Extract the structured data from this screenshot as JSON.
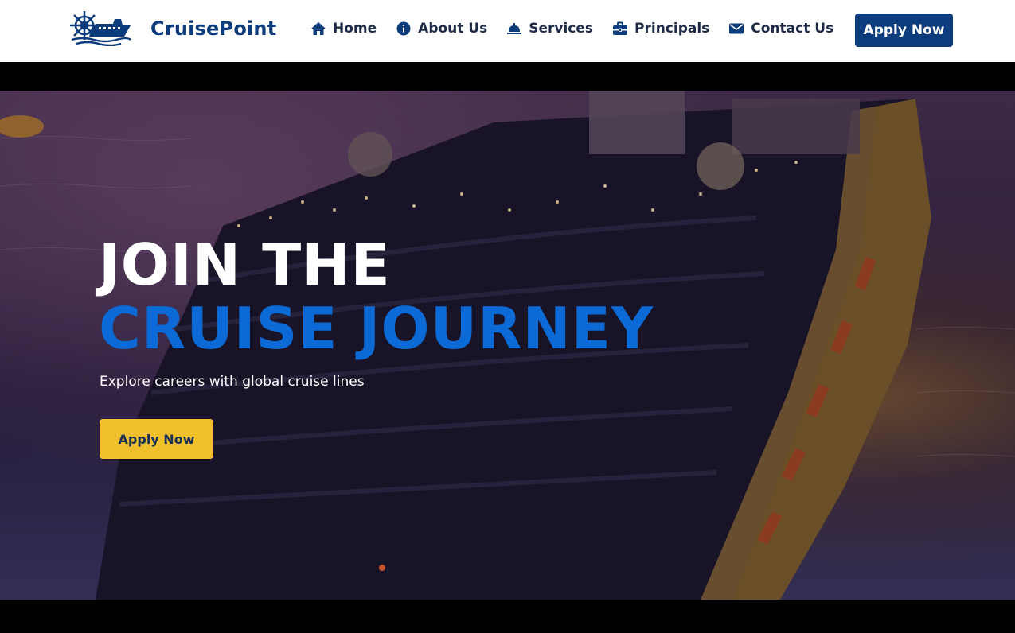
{
  "brand": {
    "name": "CruisePoint",
    "logo_icon": "ship-wheel-icon"
  },
  "nav": {
    "items": [
      {
        "label": "Home",
        "icon": "home-icon"
      },
      {
        "label": "About Us",
        "icon": "info-circle-icon"
      },
      {
        "label": "Services",
        "icon": "bell-icon"
      },
      {
        "label": "Principals",
        "icon": "briefcase-icon"
      },
      {
        "label": "Contact Us",
        "icon": "envelope-icon"
      }
    ],
    "cta_label": "Apply Now"
  },
  "hero": {
    "title_line1": "JOIN THE",
    "title_line2": "CRUISE JOURNEY",
    "subtitle": "Explore careers with global cruise lines",
    "cta_label": "Apply Now"
  },
  "colors": {
    "brand_blue": "#0c3c7c",
    "accent_blue": "#0b6ad6",
    "accent_yellow": "#f0c02c",
    "nav_text": "#1f2b46"
  }
}
